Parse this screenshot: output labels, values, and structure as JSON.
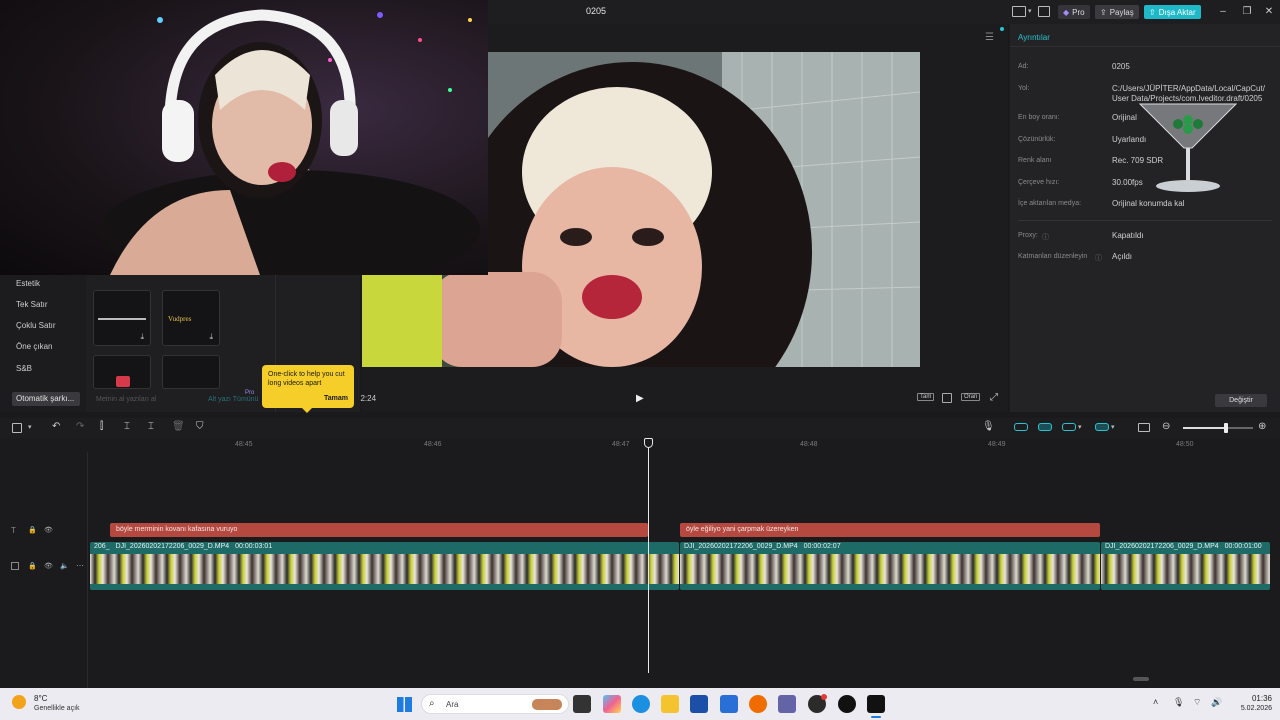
{
  "app": {
    "title": "0205",
    "pro_label": "Pro",
    "share_label": "Paylaş",
    "export_label": "Dışa Aktar"
  },
  "library": {
    "categories": [
      "Estetik",
      "Tek Satır",
      "Çoklu Satır",
      "Öne çıkan",
      "S&B",
      "Otomatik şarkı..."
    ],
    "thumb_text_2": "Vudpres",
    "bottom_text_1": "Metnin al yazıları al",
    "bottom_text_2": "Alt yazı Tümünü",
    "pro_badge": "Pro"
  },
  "tooltip": {
    "text": "One-click to help you cut long videos apart",
    "ok_label": "Tamam"
  },
  "player": {
    "time_current": "22:24",
    "btn_full": "Tam",
    "btn_ratio": "Oran"
  },
  "details": {
    "title": "Ayrıntılar",
    "rows": [
      {
        "key": "Ad:",
        "value": "0205"
      },
      {
        "key": "Yol:",
        "value": "C:/Users/JÜPİTER/AppData/Local/CapCut/User Data/Projects/com.lveditor.draft/0205"
      },
      {
        "key": "En boy oranı:",
        "value": "Orijinal"
      },
      {
        "key": "Çözünürlük:",
        "value": "Uyarlandı"
      },
      {
        "key": "Renk alanı",
        "value": "Rec. 709 SDR"
      },
      {
        "key": "Çerçeve hızı:",
        "value": "30.00fps"
      },
      {
        "key": "İçe aktarılan medya:",
        "value": "Orijinal konumda kal"
      },
      {
        "key": "Proxy:",
        "value": "Kapatıldı"
      },
      {
        "key": "Katmanları düzenleyin",
        "value": "Açıldı"
      }
    ],
    "change_label": "Değiştir"
  },
  "timeline": {
    "ticks": [
      "48:45",
      "48:46",
      "48:47",
      "48:48",
      "48:49",
      "48:50"
    ],
    "text_clips": [
      {
        "label": "böyle merminin kovanı kafasına vuruyo"
      },
      {
        "label": "öyle eğiliyo yani çarpmak üzereyken"
      }
    ],
    "video_clips": [
      {
        "prefix": "206_",
        "name": "DJI_20260202172206_0029_D.MP4",
        "duration": "00:00:03:01"
      },
      {
        "name": "DJI_20260202172206_0029_D.MP4",
        "duration": "00:00:02:07"
      },
      {
        "name": "DJI_20260202172206_0029_D.MP4",
        "duration": "00:00:01:00"
      }
    ]
  },
  "taskbar": {
    "weather_temp": "8°C",
    "weather_desc": "Genellikle açık",
    "search_label": "Ara",
    "time": "01:36",
    "date": "5.02.2026"
  }
}
